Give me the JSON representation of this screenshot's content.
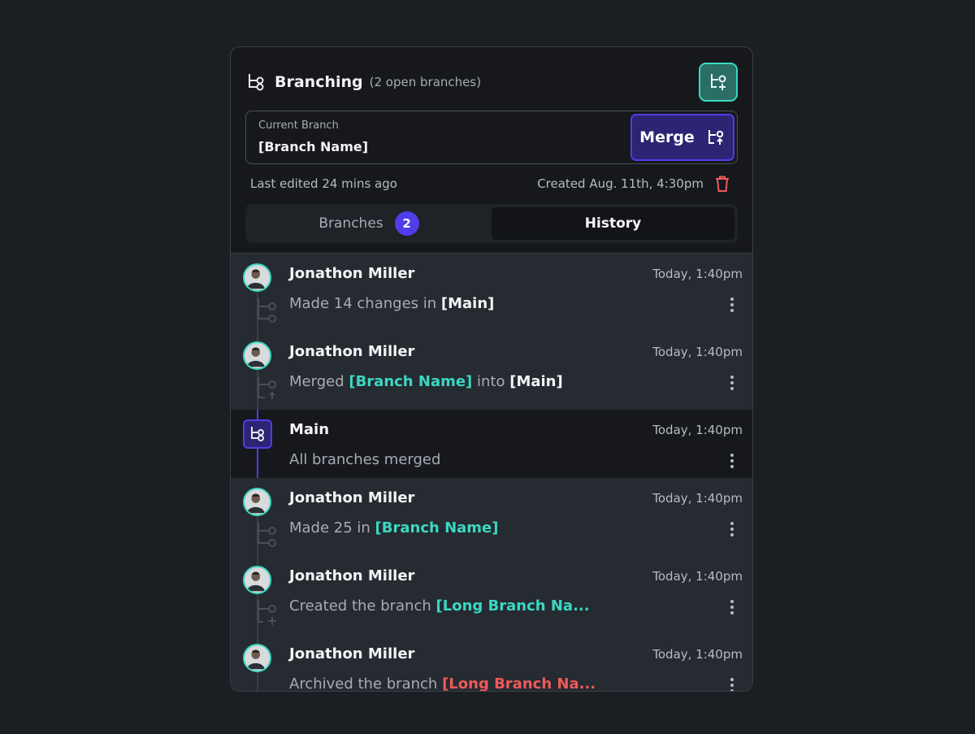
{
  "header": {
    "title": "Branching",
    "subtitle": "(2 open branches)"
  },
  "current_branch": {
    "label": "Current Branch",
    "value": "[Branch Name]",
    "merge_label": "Merge"
  },
  "meta": {
    "last_edited": "Last edited 24 mins ago",
    "created": "Created Aug. 11th, 4:30pm"
  },
  "tabs": {
    "branches_label": "Branches",
    "branches_count": "2",
    "history_label": "History"
  },
  "history": [
    {
      "name": "Jonathon Miller",
      "time": "Today, 1:40pm",
      "d1": "Made 14 changes in ",
      "d2": "[Main]"
    },
    {
      "name": "Jonathon Miller",
      "time": "Today, 1:40pm",
      "d1": "Merged ",
      "d2": "[Branch Name]",
      "d3": " into ",
      "d4": "[Main]"
    },
    {
      "name": "Main",
      "time": "Today, 1:40pm",
      "d1": "All branches merged"
    },
    {
      "name": "Jonathon Miller",
      "time": "Today, 1:40pm",
      "d1": "Made 25 in ",
      "d2": "[Branch Name]"
    },
    {
      "name": "Jonathon Miller",
      "time": "Today, 1:40pm",
      "d1": "Created the branch ",
      "d2": "[Long Branch Na..."
    },
    {
      "name": "Jonathon Miller",
      "time": "Today, 1:40pm",
      "d1": "Archived the branch ",
      "d2": "[Long Branch Na..."
    }
  ],
  "colors": {
    "accent_teal": "#3ad8c2",
    "accent_purple": "#4f3de8",
    "danger": "#ef5a5a"
  },
  "icons": [
    "branch-icon",
    "new-branch-icon",
    "merge-icon",
    "trash-icon",
    "more-vertical-icon"
  ]
}
